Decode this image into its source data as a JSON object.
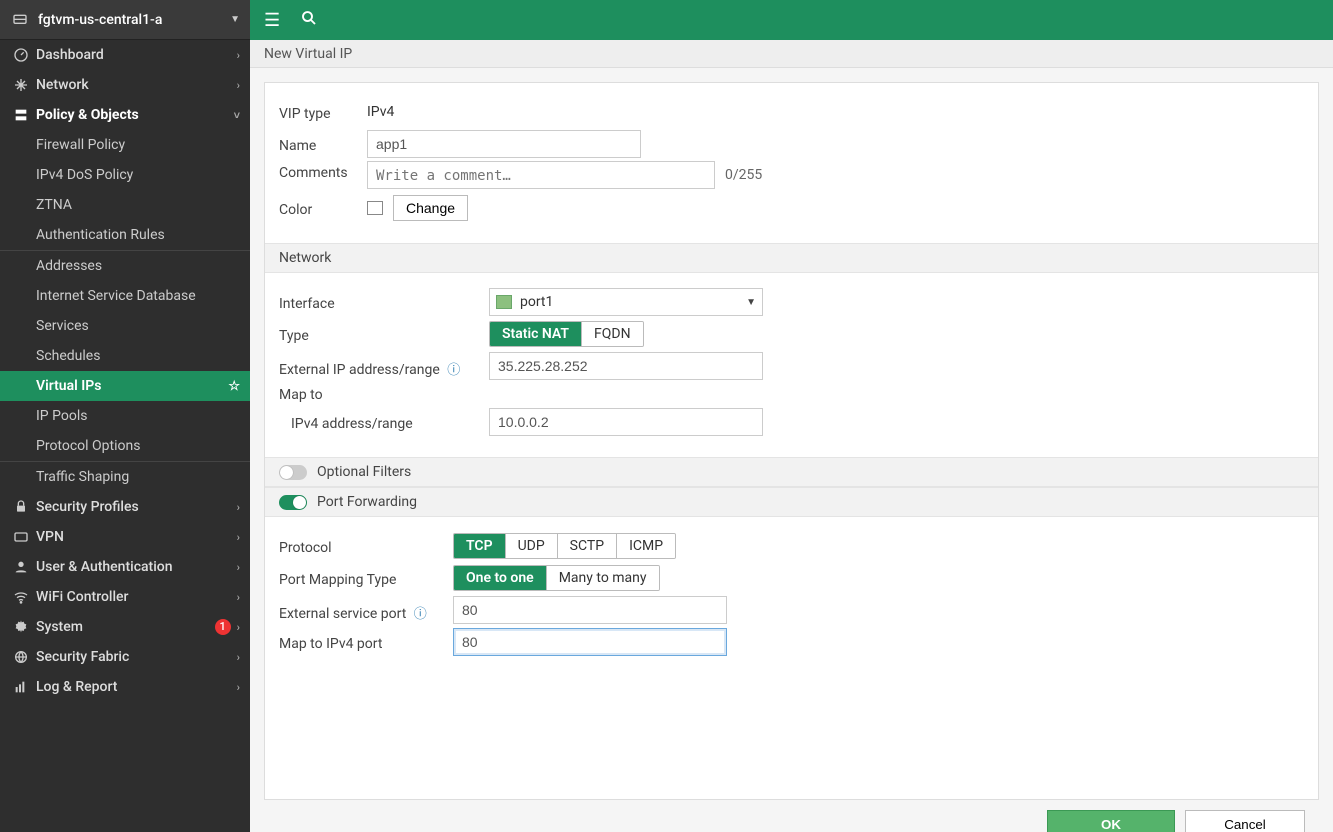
{
  "sidebar": {
    "host_label": "fgtvm-us-central1-a",
    "items": [
      {
        "label": "Dashboard"
      },
      {
        "label": "Network"
      },
      {
        "label": "Policy & Objects"
      },
      {
        "label": "Security Profiles"
      },
      {
        "label": "VPN"
      },
      {
        "label": "User & Authentication"
      },
      {
        "label": "WiFi Controller"
      },
      {
        "label": "System",
        "badge": "1"
      },
      {
        "label": "Security Fabric"
      },
      {
        "label": "Log & Report"
      }
    ],
    "policy_subitems": [
      {
        "label": "Firewall Policy"
      },
      {
        "label": "IPv4 DoS Policy"
      },
      {
        "label": "ZTNA"
      },
      {
        "label": "Authentication Rules"
      },
      {
        "label": "Addresses"
      },
      {
        "label": "Internet Service Database"
      },
      {
        "label": "Services"
      },
      {
        "label": "Schedules"
      },
      {
        "label": "Virtual IPs"
      },
      {
        "label": "IP Pools"
      },
      {
        "label": "Protocol Options"
      },
      {
        "label": "Traffic Shaping"
      }
    ]
  },
  "page": {
    "title": "New Virtual IP",
    "vip_type_label": "VIP type",
    "vip_type_value": "IPv4",
    "name_label": "Name",
    "name_value": "app1",
    "comments_label": "Comments",
    "comments_placeholder": "Write a comment…",
    "comments_counter": "0/255",
    "color_label": "Color",
    "change_btn": "Change",
    "network_header": "Network",
    "interface_label": "Interface",
    "interface_value": "port1",
    "type_label": "Type",
    "type_opts": [
      "Static NAT",
      "FQDN"
    ],
    "ext_ip_label": "External IP address/range",
    "ext_ip_value": "35.225.28.252",
    "mapto_label": "Map to",
    "ipv4_range_label": "IPv4 address/range",
    "ipv4_range_value": "10.0.0.2",
    "optional_filters": "Optional Filters",
    "port_forwarding": "Port Forwarding",
    "protocol_label": "Protocol",
    "protocol_opts": [
      "TCP",
      "UDP",
      "SCTP",
      "ICMP"
    ],
    "port_mapping_label": "Port Mapping Type",
    "port_mapping_opts": [
      "One to one",
      "Many to many"
    ],
    "ext_port_label": "External service port",
    "ext_port_value": "80",
    "map_port_label": "Map to IPv4 port",
    "map_port_value": "80",
    "ok": "OK",
    "cancel": "Cancel"
  }
}
